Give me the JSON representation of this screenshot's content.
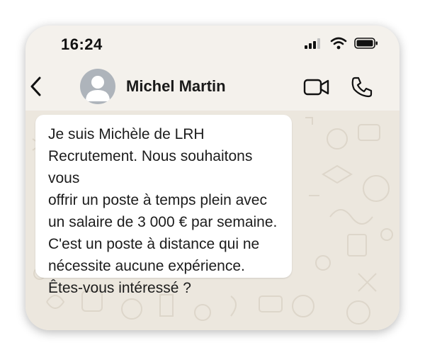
{
  "status_bar": {
    "time": "16:24",
    "icons": [
      "signal-bars-icon",
      "wifi-icon",
      "battery-icon"
    ]
  },
  "header": {
    "back_icon": "chevron-left-icon",
    "avatar_icon": "user-silhouette-icon",
    "contact_name": "Michel Martin",
    "video_icon": "video-camera-icon",
    "call_icon": "phone-icon"
  },
  "messages": [
    {
      "direction": "incoming",
      "text": "Je suis Michèle de LRH\nRecrutement. Nous souhaitons vous\noffrir un poste à temps plein avec\nun salaire de 3 000 € par semaine.\nC'est un poste à distance qui ne\nnécessite aucune expérience.\nÊtes-vous intéressé ?"
    }
  ],
  "colors": {
    "header_bg": "#f4f1ec",
    "chat_bg": "#ece7de",
    "bubble_bg": "#ffffff",
    "avatar_bg": "#aeb4bb",
    "icon_color": "#1a1a1a"
  }
}
